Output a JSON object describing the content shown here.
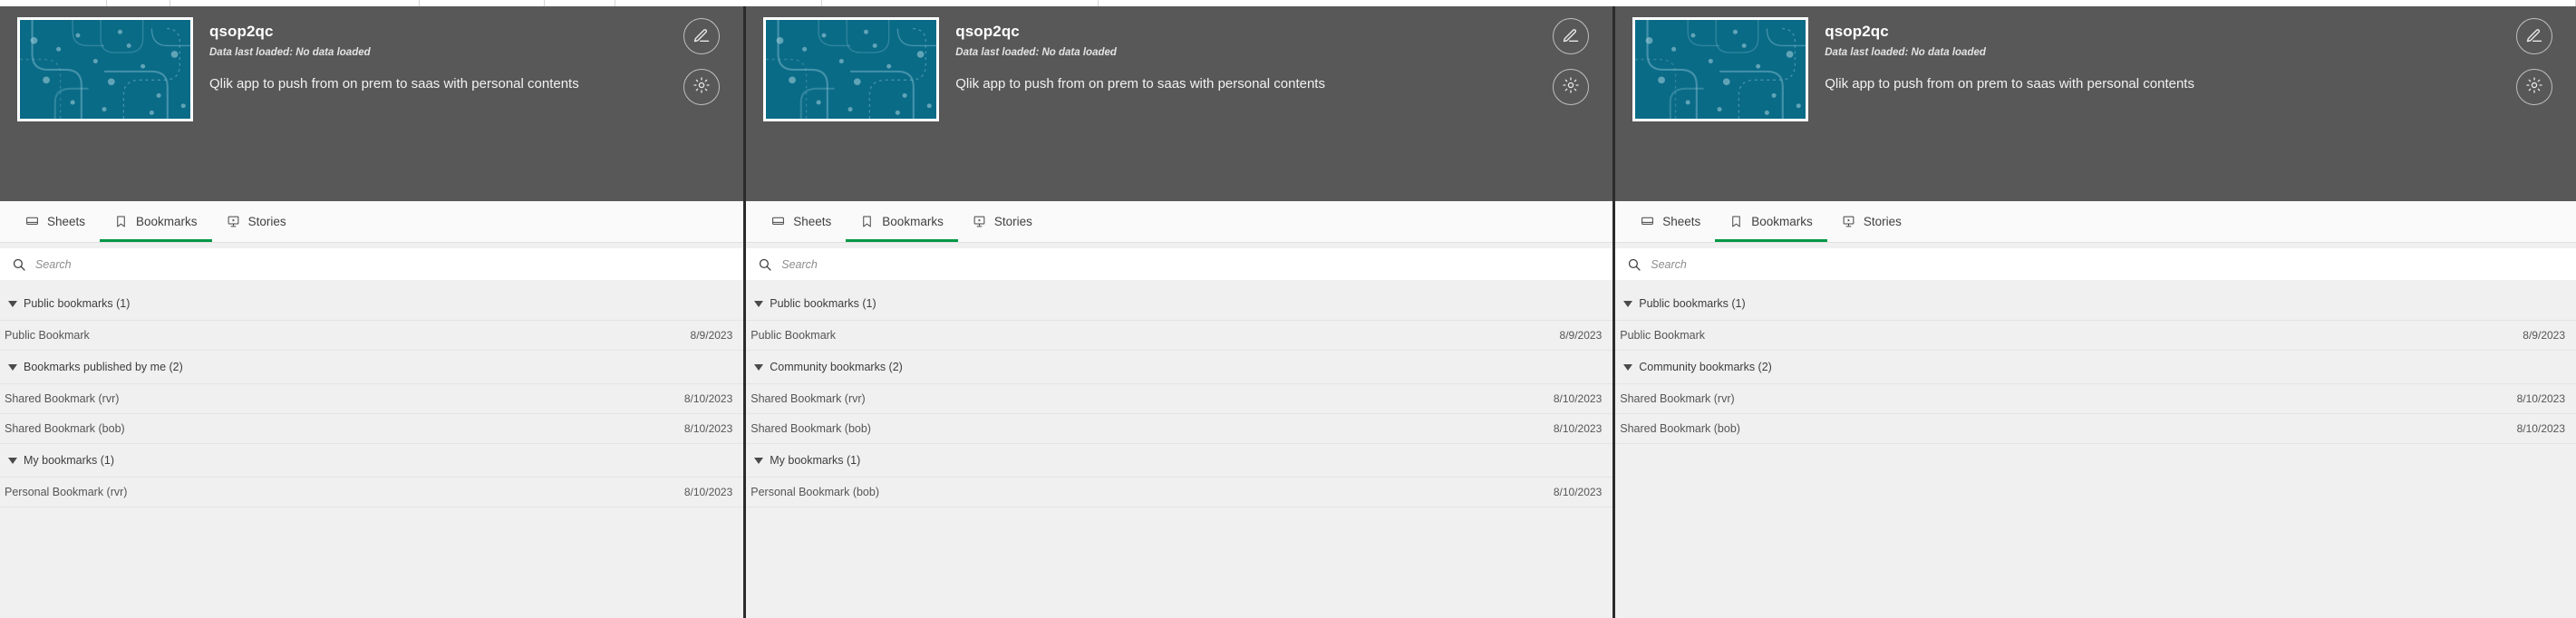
{
  "top_strip_segments": 8,
  "colors": {
    "header_bg": "#585858",
    "accent_green": "#009845",
    "thumb_teal": "#0a6b87",
    "divider": "#2b2b2b",
    "list_bg": "#f0f0f0"
  },
  "app": {
    "title": "qsop2qc",
    "data_loaded": "Data last loaded: No data loaded",
    "description": "Qlik app to push from on prem to saas with personal contents",
    "thumbnail_alt": "app-thumbnail",
    "actions": [
      {
        "name": "edit-app-button",
        "icon": "pencil-icon"
      },
      {
        "name": "app-settings-button",
        "icon": "gear-icon"
      }
    ]
  },
  "tabs": [
    {
      "label": "Sheets",
      "icon": "sheet-icon",
      "active": false
    },
    {
      "label": "Bookmarks",
      "icon": "bookmark-icon",
      "active": true
    },
    {
      "label": "Stories",
      "icon": "story-icon",
      "active": false
    }
  ],
  "search": {
    "value": "",
    "placeholder": "Search",
    "icon": "search-icon"
  },
  "panels": [
    {
      "id": "panel-1",
      "groups": [
        {
          "label": "Public bookmarks (1)",
          "expanded": true,
          "rows": [
            {
              "name": "Public Bookmark",
              "date": "8/9/2023"
            }
          ]
        },
        {
          "label": "Bookmarks published by me (2)",
          "expanded": true,
          "rows": [
            {
              "name": "Shared Bookmark (rvr)",
              "date": "8/10/2023"
            },
            {
              "name": "Shared Bookmark (bob)",
              "date": "8/10/2023"
            }
          ]
        },
        {
          "label": "My bookmarks (1)",
          "expanded": true,
          "rows": [
            {
              "name": "Personal Bookmark (rvr)",
              "date": "8/10/2023"
            }
          ]
        }
      ]
    },
    {
      "id": "panel-2",
      "groups": [
        {
          "label": "Public bookmarks (1)",
          "expanded": true,
          "rows": [
            {
              "name": "Public Bookmark",
              "date": "8/9/2023"
            }
          ]
        },
        {
          "label": "Community bookmarks (2)",
          "expanded": true,
          "rows": [
            {
              "name": "Shared Bookmark (rvr)",
              "date": "8/10/2023"
            },
            {
              "name": "Shared Bookmark (bob)",
              "date": "8/10/2023"
            }
          ]
        },
        {
          "label": "My bookmarks (1)",
          "expanded": true,
          "rows": [
            {
              "name": "Personal Bookmark (bob)",
              "date": "8/10/2023"
            }
          ]
        }
      ]
    },
    {
      "id": "panel-3",
      "groups": [
        {
          "label": "Public bookmarks (1)",
          "expanded": true,
          "rows": [
            {
              "name": "Public Bookmark",
              "date": "8/9/2023"
            }
          ]
        },
        {
          "label": "Community bookmarks (2)",
          "expanded": true,
          "rows": [
            {
              "name": "Shared Bookmark (rvr)",
              "date": "8/10/2023"
            },
            {
              "name": "Shared Bookmark (bob)",
              "date": "8/10/2023"
            }
          ]
        }
      ]
    }
  ]
}
